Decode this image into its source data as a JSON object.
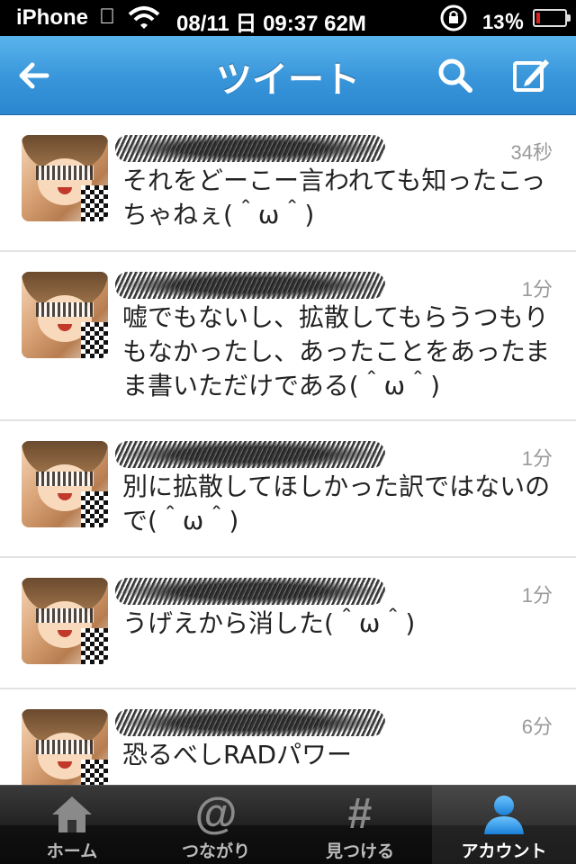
{
  "status_bar": {
    "carrier": "iPhone",
    "clock": "08/11 日 09:37 62M",
    "battery_percent": "13％",
    "battery_level": 0.13
  },
  "nav": {
    "title": "ツイート",
    "back_icon": "back-arrow-icon",
    "search_icon": "search-icon",
    "compose_icon": "compose-icon"
  },
  "tweets": [
    {
      "time": "34秒",
      "text": "それをどーこー言われても知ったこっちゃねぇ(＾ω＾)"
    },
    {
      "time": "1分",
      "text": "嘘でもないし、拡散してもらうつもりもなかったし、あったことをあったまま書いただけである(＾ω＾)"
    },
    {
      "time": "1分",
      "text": "別に拡散してほしかった訳ではないので(＾ω＾)"
    },
    {
      "time": "1分",
      "text": "うげえから消した(＾ω＾)"
    },
    {
      "time": "6分",
      "text": "恐るべしRADパワー"
    }
  ],
  "tabs": [
    {
      "label": "ホーム",
      "icon": "home-icon"
    },
    {
      "label": "つながり",
      "icon": "at-icon"
    },
    {
      "label": "見つける",
      "icon": "hash-icon"
    },
    {
      "label": "アカウント",
      "icon": "account-icon",
      "active": true
    }
  ],
  "colors": {
    "nav_blue": "#3a97db",
    "battery_red": "#e02020"
  }
}
